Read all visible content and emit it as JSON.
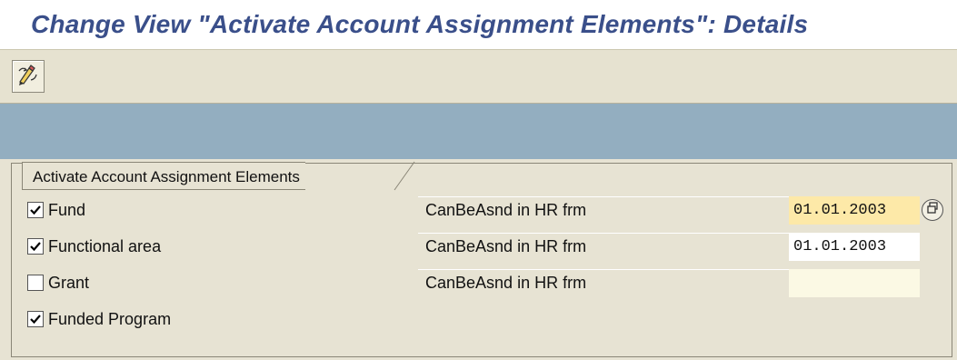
{
  "screen": {
    "title": "Change View \"Activate Account Assignment Elements\": Details"
  },
  "toolbar": {
    "buttons": [
      {
        "icon": "display-change-icon",
        "tooltip": ""
      }
    ]
  },
  "group": {
    "title": "Activate Account Assignment Elements"
  },
  "rows": [
    {
      "label": "Fund",
      "checked": true,
      "field_label": "CanBeAsnd in HR frm",
      "date": "01.01.2003",
      "focused": true
    },
    {
      "label": "Functional area",
      "checked": true,
      "field_label": "CanBeAsnd in HR frm",
      "date": "01.01.2003",
      "focused": false
    },
    {
      "label": "Grant",
      "checked": false,
      "field_label": "CanBeAsnd in HR frm",
      "date": "",
      "focused": false
    },
    {
      "label": "Funded Program",
      "checked": true
    }
  ],
  "colors": {
    "title": "#3a4f8a",
    "toolbar": "#e6e2d0",
    "band": "#93aec0",
    "content": "#e7e3d3",
    "focused_input": "#fde9a8"
  }
}
